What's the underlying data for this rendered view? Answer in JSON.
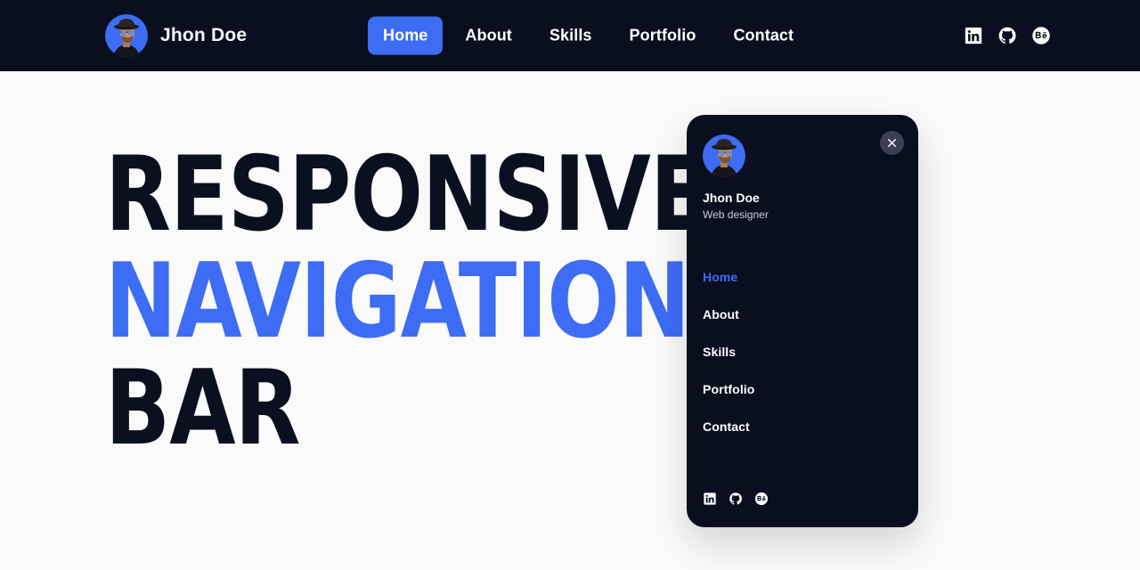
{
  "header": {
    "brand": {
      "name": "Jhon Doe",
      "avatar_icon": "user-avatar"
    },
    "nav": [
      {
        "label": "Home",
        "active": true
      },
      {
        "label": "About",
        "active": false
      },
      {
        "label": "Skills",
        "active": false
      },
      {
        "label": "Portfolio",
        "active": false
      },
      {
        "label": "Contact",
        "active": false
      }
    ],
    "socials": [
      {
        "name": "linkedin-icon",
        "label": "LinkedIn"
      },
      {
        "name": "github-icon",
        "label": "GitHub"
      },
      {
        "name": "behance-icon",
        "label": "Behance"
      }
    ]
  },
  "hero": {
    "line1": "RESPONSIVE",
    "line2": "NAVIGATION",
    "line3": "BAR"
  },
  "panel": {
    "close_label": "×",
    "profile": {
      "name": "Jhon Doe",
      "role": "Web designer",
      "avatar_icon": "user-avatar"
    },
    "menu": [
      {
        "label": "Home",
        "active": true
      },
      {
        "label": "About",
        "active": false
      },
      {
        "label": "Skills",
        "active": false
      },
      {
        "label": "Portfolio",
        "active": false
      },
      {
        "label": "Contact",
        "active": false
      }
    ],
    "socials": [
      {
        "name": "linkedin-icon",
        "label": "LinkedIn"
      },
      {
        "name": "github-icon",
        "label": "GitHub"
      },
      {
        "name": "behance-icon",
        "label": "Behance"
      }
    ]
  },
  "colors": {
    "accent": "#3d6cf5",
    "header_bg": "#0a0f20",
    "page_bg": "#fafafa",
    "heading": "#0b1020",
    "close_btn_bg": "#3b4055"
  }
}
